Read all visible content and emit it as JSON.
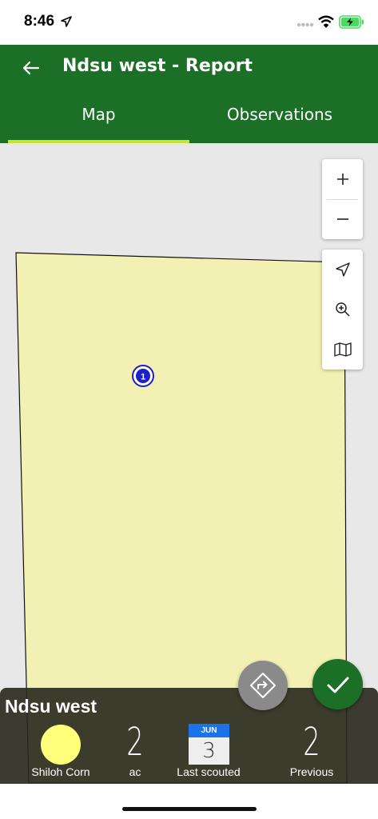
{
  "status_bar": {
    "time": "8:46"
  },
  "header": {
    "title": "Ndsu west - Report",
    "tabs": [
      {
        "label": "Map",
        "active": true
      },
      {
        "label": "Observations",
        "active": false
      }
    ],
    "color": "#1c6f26",
    "indicator_color": "#c6e233"
  },
  "map": {
    "zoom_in_icon": "plus-icon",
    "zoom_out_icon": "minus-icon",
    "tools": [
      "locate-icon",
      "zoom-extent-icon",
      "map-layers-icon"
    ],
    "field_color": "#f2f1b3",
    "marker_label": "1"
  },
  "actions": {
    "route_icon": "route-icon",
    "done_icon": "checkmark-icon"
  },
  "summary": {
    "field_name": "Ndsu west",
    "crop_label": "Shiloh Corn",
    "crop_color": "#ffff7a",
    "area_value": "2",
    "area_unit": "ac",
    "last_scouted_month": "JUN",
    "last_scouted_day": "3",
    "last_scouted_label": "Last scouted",
    "previous_value": "2",
    "previous_label": "Previous"
  }
}
